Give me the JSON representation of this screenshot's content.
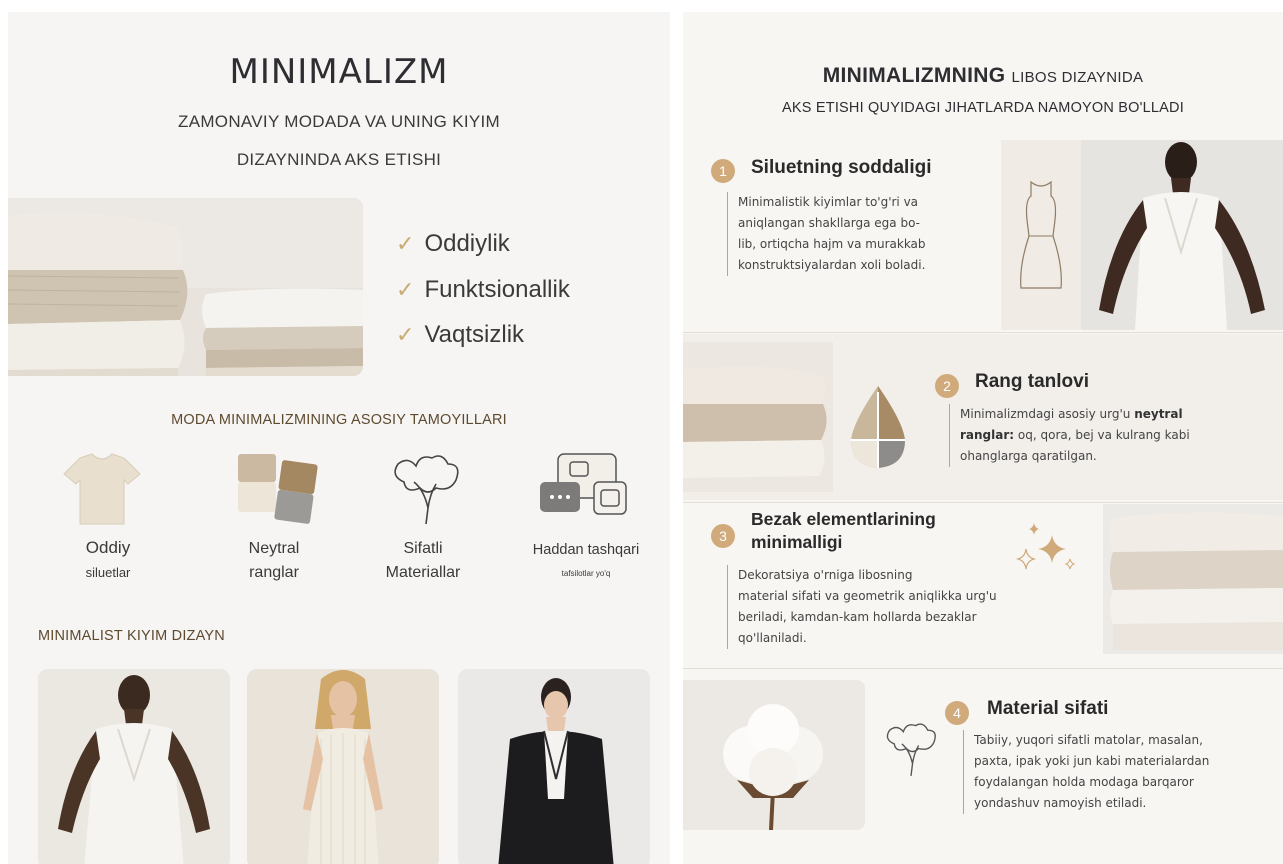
{
  "left": {
    "title": "MINIMALIZM",
    "subtitle_line1": "ZAMONAVIY MODADA VA UNING KIYIM",
    "subtitle_line2": "DIZAYNINDA AKS ETISHI",
    "checklist": [
      "Oddiylik",
      "Funktsionallik",
      "Vaqtsizlik"
    ],
    "principles_heading": "MODA MINIMALIZMINING ASOSIY TAMOYILLARI",
    "principles": [
      {
        "label1": "Oddiy",
        "label2": "siluetlar",
        "icon": "tshirt-icon"
      },
      {
        "label1": "Neytral",
        "label2": "ranglar",
        "icon": "color-swatches-icon"
      },
      {
        "label1": "Sifatli",
        "label2": "Materiallar",
        "icon": "cotton-flower-icon"
      },
      {
        "label1": "Haddan tashqari",
        "label2": "tafsilotlar yo'q",
        "icon": "detail-blocks-icon"
      }
    ],
    "designs_heading": "MINIMALIST KIYIM DIZAYN"
  },
  "right": {
    "title_bold": "MINIMALIZMNING",
    "title_rest": "LIBOS DIZAYNIDA",
    "subtitle": "AKS ETISHI QUYIDAGI JIHATLARDA NAMOYON BO'LLADI",
    "features": [
      {
        "number": "1",
        "heading": "Siluetning soddaligi",
        "lines": [
          "Minimalistik kiyimlar to'g'ri va",
          "aniqlangan shakllarga ega bo-",
          "lib, ortiqcha hajm va murakkab",
          "konstruktsiyalardan xoli boladi."
        ]
      },
      {
        "number": "2",
        "heading": "Rang tanlovi",
        "line1_pre": "Minimalizmdagi asosiy urg'u ",
        "line1_bold": "neytral",
        "line2_bold": "ranglar:",
        "line2_rest": " oq, qora, bej va kulrang kabi",
        "line3": "ohanglarga qaratilgan."
      },
      {
        "number": "3",
        "heading_line1": "Bezak elementlarining",
        "heading_line2": "minimalligi",
        "lines": [
          "Dekoratsiya o'rniga libosning",
          "material sifati va geometrik aniqlikka urg'u",
          "beriladi, kamdan-kam hollarda bezaklar",
          "qo'llaniladi."
        ]
      },
      {
        "number": "4",
        "heading": "Material sifati",
        "lines": [
          "Tabiiy, yuqori sifatli matolar, masalan,",
          "paxta, ipak yoki jun kabi materialardan",
          "foydalangan holda modaga barqaror",
          "yondashuv namoyish etiladi."
        ]
      }
    ]
  },
  "colors": {
    "accent_gold": "#c9aa72",
    "number_badge": "#d1aa7b",
    "heading_brown": "#5e4a2f",
    "background": "#f6f5f3"
  }
}
